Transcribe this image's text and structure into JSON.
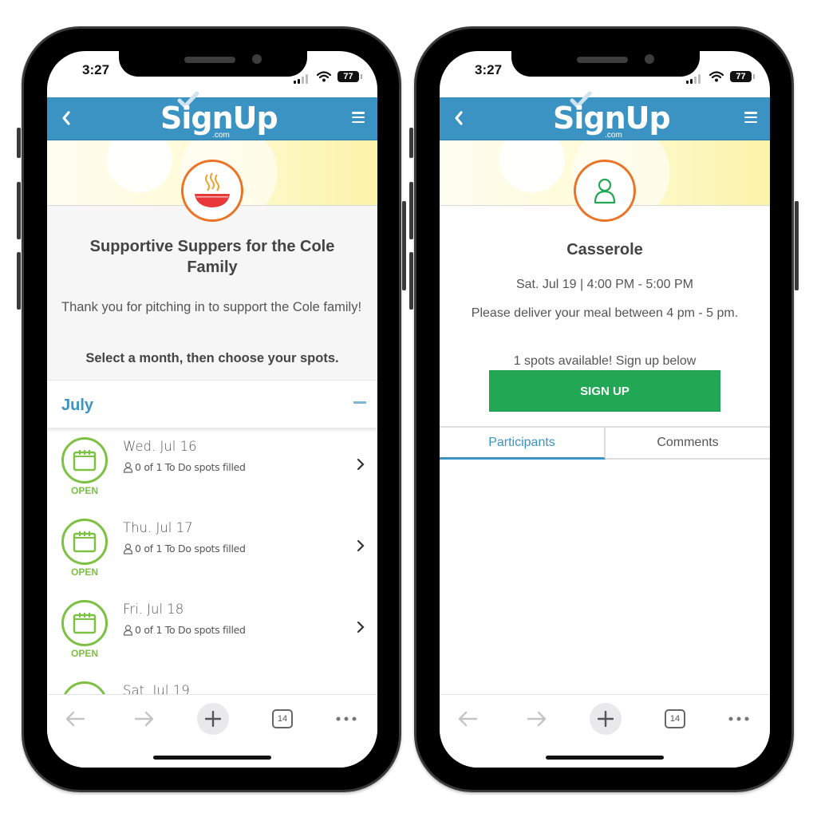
{
  "left_phone": {
    "status_bar": {
      "time": "3:27",
      "battery": "77"
    },
    "header": {
      "logo": "SignUp",
      "logo_domain": ".com"
    },
    "event": {
      "icon": "soup-bowl-icon",
      "title": "Supportive Suppers for the Cole Family",
      "description": "Thank you for pitching in to support the Cole family!",
      "instruction": "Select a month, then choose your spots."
    },
    "month": {
      "label": "July",
      "expanded": true
    },
    "slots": [
      {
        "date": "Wed. Jul 16",
        "filled": "0 of 1 To Do spots filled",
        "status": "OPEN"
      },
      {
        "date": "Thu. Jul 17",
        "filled": "0 of 1 To Do spots filled",
        "status": "OPEN"
      },
      {
        "date": "Fri. Jul 18",
        "filled": "0 of 1 To Do spots filled",
        "status": "OPEN"
      },
      {
        "date": "Sat. Jul 19",
        "filled": "",
        "status": ""
      }
    ],
    "toolbar": {
      "tab_count": "14"
    }
  },
  "right_phone": {
    "status_bar": {
      "time": "3:27",
      "battery": "77"
    },
    "header": {
      "logo": "SignUp",
      "logo_domain": ".com"
    },
    "slot_detail": {
      "icon": "person-icon",
      "title": "Casserole",
      "when": "Sat. Jul 19 | 4:00 PM - 5:00 PM",
      "note": "Please deliver your meal between 4 pm - 5 pm.",
      "availability": "1 spots available! Sign up below",
      "signup_label": "SIGN UP"
    },
    "tabs": [
      {
        "label": "Participants",
        "active": true
      },
      {
        "label": "Comments",
        "active": false
      }
    ],
    "toolbar": {
      "tab_count": "14"
    }
  },
  "colors": {
    "brand_blue": "#3a93c2",
    "accent_orange": "#ea7325",
    "open_green": "#7cc142",
    "signup_green": "#22a755"
  }
}
